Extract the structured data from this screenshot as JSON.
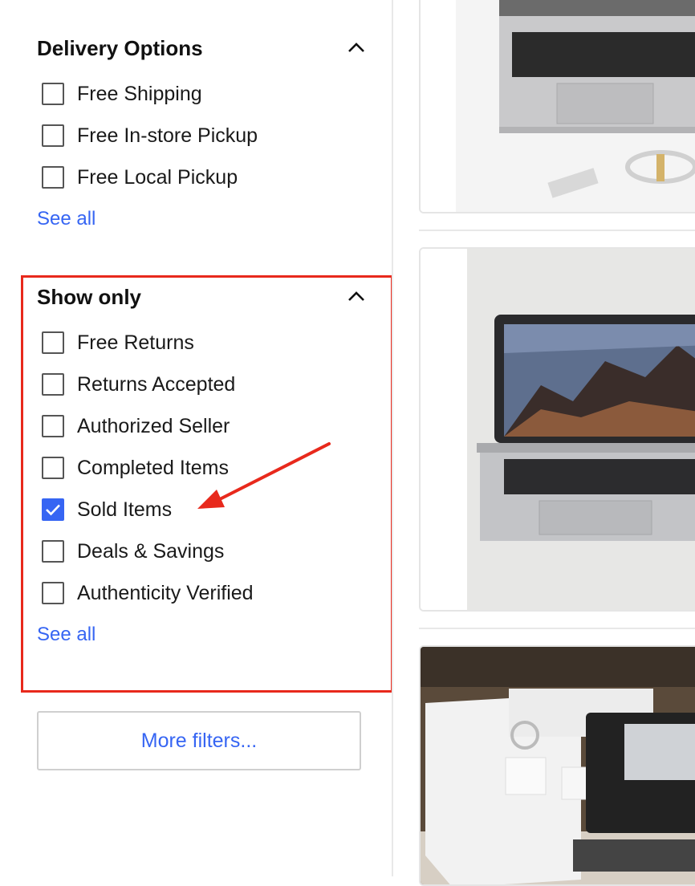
{
  "delivery": {
    "title": "Delivery Options",
    "options": [
      {
        "label": "Free Shipping",
        "checked": false
      },
      {
        "label": "Free In-store Pickup",
        "checked": false
      },
      {
        "label": "Free Local Pickup",
        "checked": false
      }
    ],
    "see_all": "See all"
  },
  "show_only": {
    "title": "Show only",
    "options": [
      {
        "label": "Free Returns",
        "checked": false
      },
      {
        "label": "Returns Accepted",
        "checked": false
      },
      {
        "label": "Authorized Seller",
        "checked": false
      },
      {
        "label": "Completed Items",
        "checked": false
      },
      {
        "label": "Sold Items",
        "checked": true
      },
      {
        "label": "Deals & Savings",
        "checked": false
      },
      {
        "label": "Authenticity Verified",
        "checked": false
      }
    ],
    "see_all": "See all"
  },
  "more_filters": "More filters...",
  "colors": {
    "accent": "#3665f3",
    "highlight": "#e8291c"
  },
  "icons": {
    "collapse": "chevron-up-icon",
    "check": "checkmark-icon"
  }
}
